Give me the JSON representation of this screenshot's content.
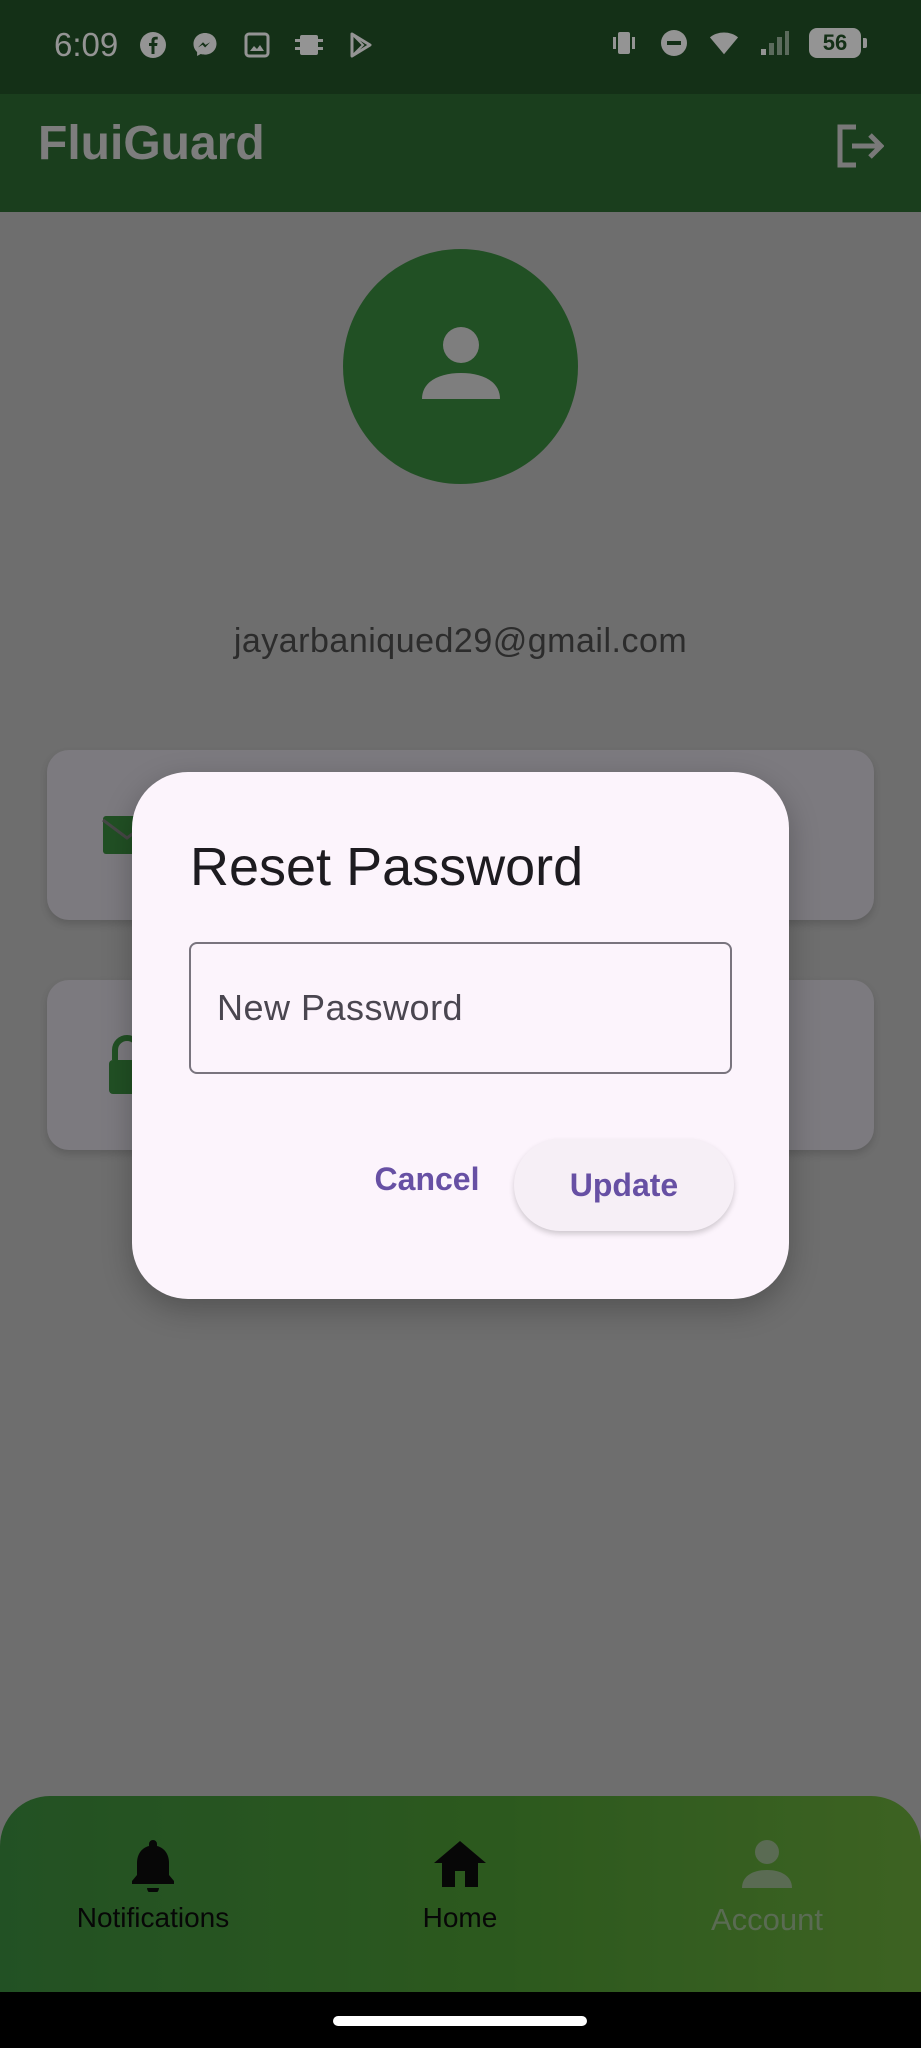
{
  "status_bar": {
    "time": "6:09",
    "battery": "56",
    "left_icons": [
      "facebook-icon",
      "messenger-icon",
      "gallery-icon",
      "chip-icon",
      "play-store-icon"
    ],
    "right_icons": [
      "vibrate-icon",
      "do-not-disturb-icon",
      "wifi-icon",
      "signal-icon",
      "battery-icon"
    ]
  },
  "app_bar": {
    "title": "FluiGuard",
    "logout_icon": "logout-icon"
  },
  "profile": {
    "email": "jayarbaniqued29@gmail.com",
    "avatar_icon": "person-icon"
  },
  "cards": [
    {
      "icon": "mail-icon"
    },
    {
      "icon": "lock-icon"
    }
  ],
  "dialog": {
    "title": "Reset Password",
    "field_placeholder": "New Password",
    "field_value": "",
    "cancel_label": "Cancel",
    "update_label": "Update"
  },
  "bottom_nav": {
    "items": [
      {
        "label": "Notifications",
        "icon": "bell-icon"
      },
      {
        "label": "Home",
        "icon": "home-icon"
      },
      {
        "label": "Account",
        "icon": "person-icon",
        "selected": true
      }
    ]
  },
  "colors": {
    "app_bar": "#2e6b33",
    "avatar": "#3a8a3f",
    "accent": "#6750a4",
    "dialog_bg": "#fcf4fc"
  }
}
